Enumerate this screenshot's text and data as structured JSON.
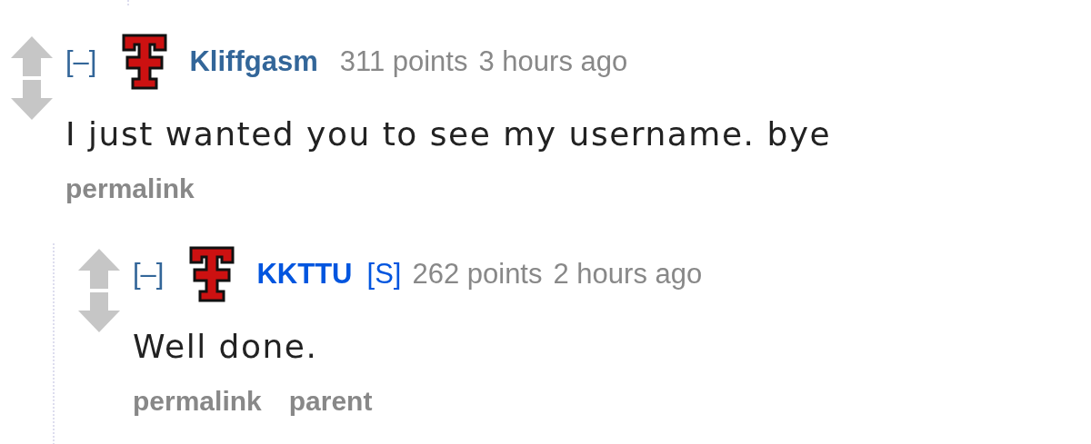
{
  "comments": [
    {
      "collapse": "[–]",
      "author": "Kliffgasm",
      "submitter": false,
      "score": "311 points",
      "time": "3 hours ago",
      "body": "I just wanted you to see my username. bye",
      "buttons": [
        "permalink"
      ],
      "children": [
        {
          "collapse": "[–]",
          "author": "KKTTU",
          "submitter": true,
          "submitter_tag": "[S]",
          "score": "262 points",
          "time": "2 hours ago",
          "body": "Well done.",
          "buttons": [
            "permalink",
            "parent"
          ]
        }
      ]
    }
  ]
}
